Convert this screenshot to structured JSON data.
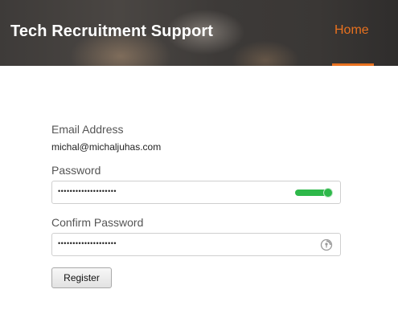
{
  "header": {
    "brand": "Tech Recruitment Support",
    "nav": {
      "home": "Home"
    }
  },
  "form": {
    "email_label": "Email Address",
    "email_value": "michal@michaljuhas.com",
    "password_label": "Password",
    "password_mask": "••••••••••••••••••••",
    "confirm_label": "Confirm Password",
    "confirm_mask": "••••••••••••••••••••",
    "register_label": "Register"
  },
  "colors": {
    "accent": "#e8711f",
    "strength": "#2eb84a"
  },
  "icons": {
    "password_strength": "password-strength-icon",
    "confirm_autofill": "keychain-icon"
  }
}
